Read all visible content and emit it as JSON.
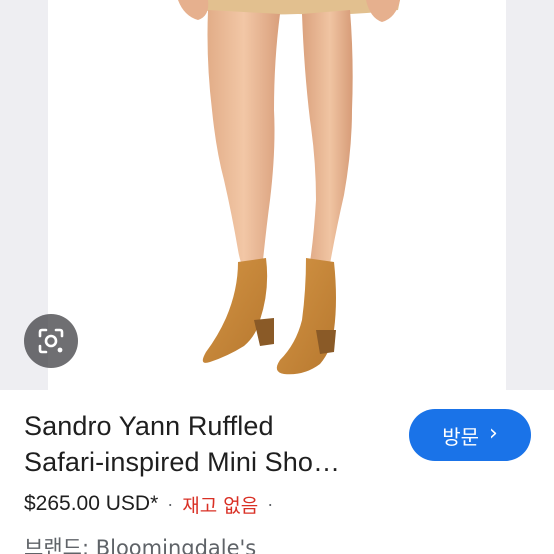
{
  "product": {
    "title_line1": "Sandro Yann Ruffled",
    "title_line2": "Safari-inspired Mini Sho…",
    "price": "$265.00 USD*",
    "separator": "·",
    "stock_status": "재고 없음",
    "brand_line": "브랜드: Bloomingdale's"
  },
  "actions": {
    "visit_label": "방문",
    "visit_chevron": "›",
    "lens_icon": "google-lens-icon"
  },
  "colors": {
    "visit_button": "#1a73e8",
    "stock_status": "#d93025",
    "boots": "#c8893c",
    "skin": "#e9b894"
  }
}
